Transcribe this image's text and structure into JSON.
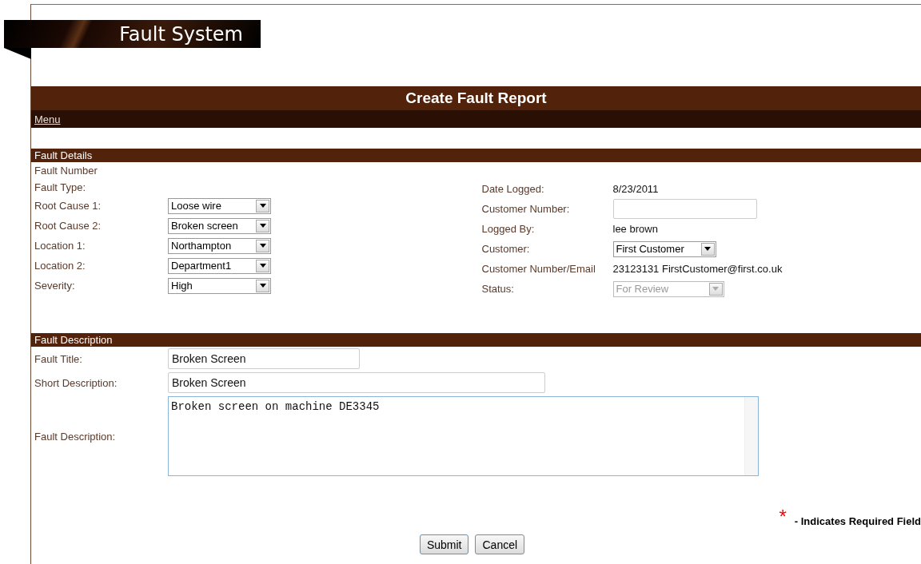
{
  "logo": {
    "title": "Fault System"
  },
  "page_title": "Create Fault Report",
  "menu_link": "Menu",
  "fault_details": {
    "heading": "Fault Details",
    "left": [
      {
        "kind": "text",
        "label": "Fault Number"
      },
      {
        "kind": "text",
        "label": "Fault Type:"
      },
      {
        "kind": "select",
        "label": "Root Cause 1:",
        "value": "Loose wire",
        "disabled": false
      },
      {
        "kind": "select",
        "label": "Root Cause 2:",
        "value": "Broken screen",
        "disabled": false
      },
      {
        "kind": "select",
        "label": "Location 1:",
        "value": "Northampton",
        "disabled": false
      },
      {
        "kind": "select",
        "label": "Location 2:",
        "value": "Department1",
        "disabled": false
      },
      {
        "kind": "select",
        "label": "Severity:",
        "value": "High",
        "disabled": false
      }
    ],
    "right": [
      {
        "kind": "value",
        "label": "Date Logged:",
        "value": "8/23/2011"
      },
      {
        "kind": "input",
        "label": "Customer Number:"
      },
      {
        "kind": "value",
        "label": "Logged By:",
        "value": "lee brown"
      },
      {
        "kind": "select",
        "label": "Customer:",
        "value": "First Customer",
        "disabled": false
      },
      {
        "kind": "value",
        "label": "Customer Number/Email",
        "value": "23123131 FirstCustomer@first.co.uk"
      },
      {
        "kind": "select",
        "label": "Status:",
        "value": "For Review",
        "disabled": true
      }
    ]
  },
  "fault_description": {
    "heading": "Fault Description",
    "fields": [
      {
        "kind": "input",
        "label": "Fault Title:",
        "value": "Broken Screen"
      },
      {
        "kind": "input",
        "label": "Short Description:",
        "value": "Broken Screen"
      },
      {
        "kind": "textarea",
        "label": "Fault Description:",
        "value": "Broken screen on machine DE3345"
      }
    ]
  },
  "required_note": {
    "mark": "*",
    "text": "- Indicates Required Field"
  },
  "buttons": [
    {
      "label": "Submit",
      "focused": true
    },
    {
      "label": "Cancel",
      "focused": false
    }
  ]
}
